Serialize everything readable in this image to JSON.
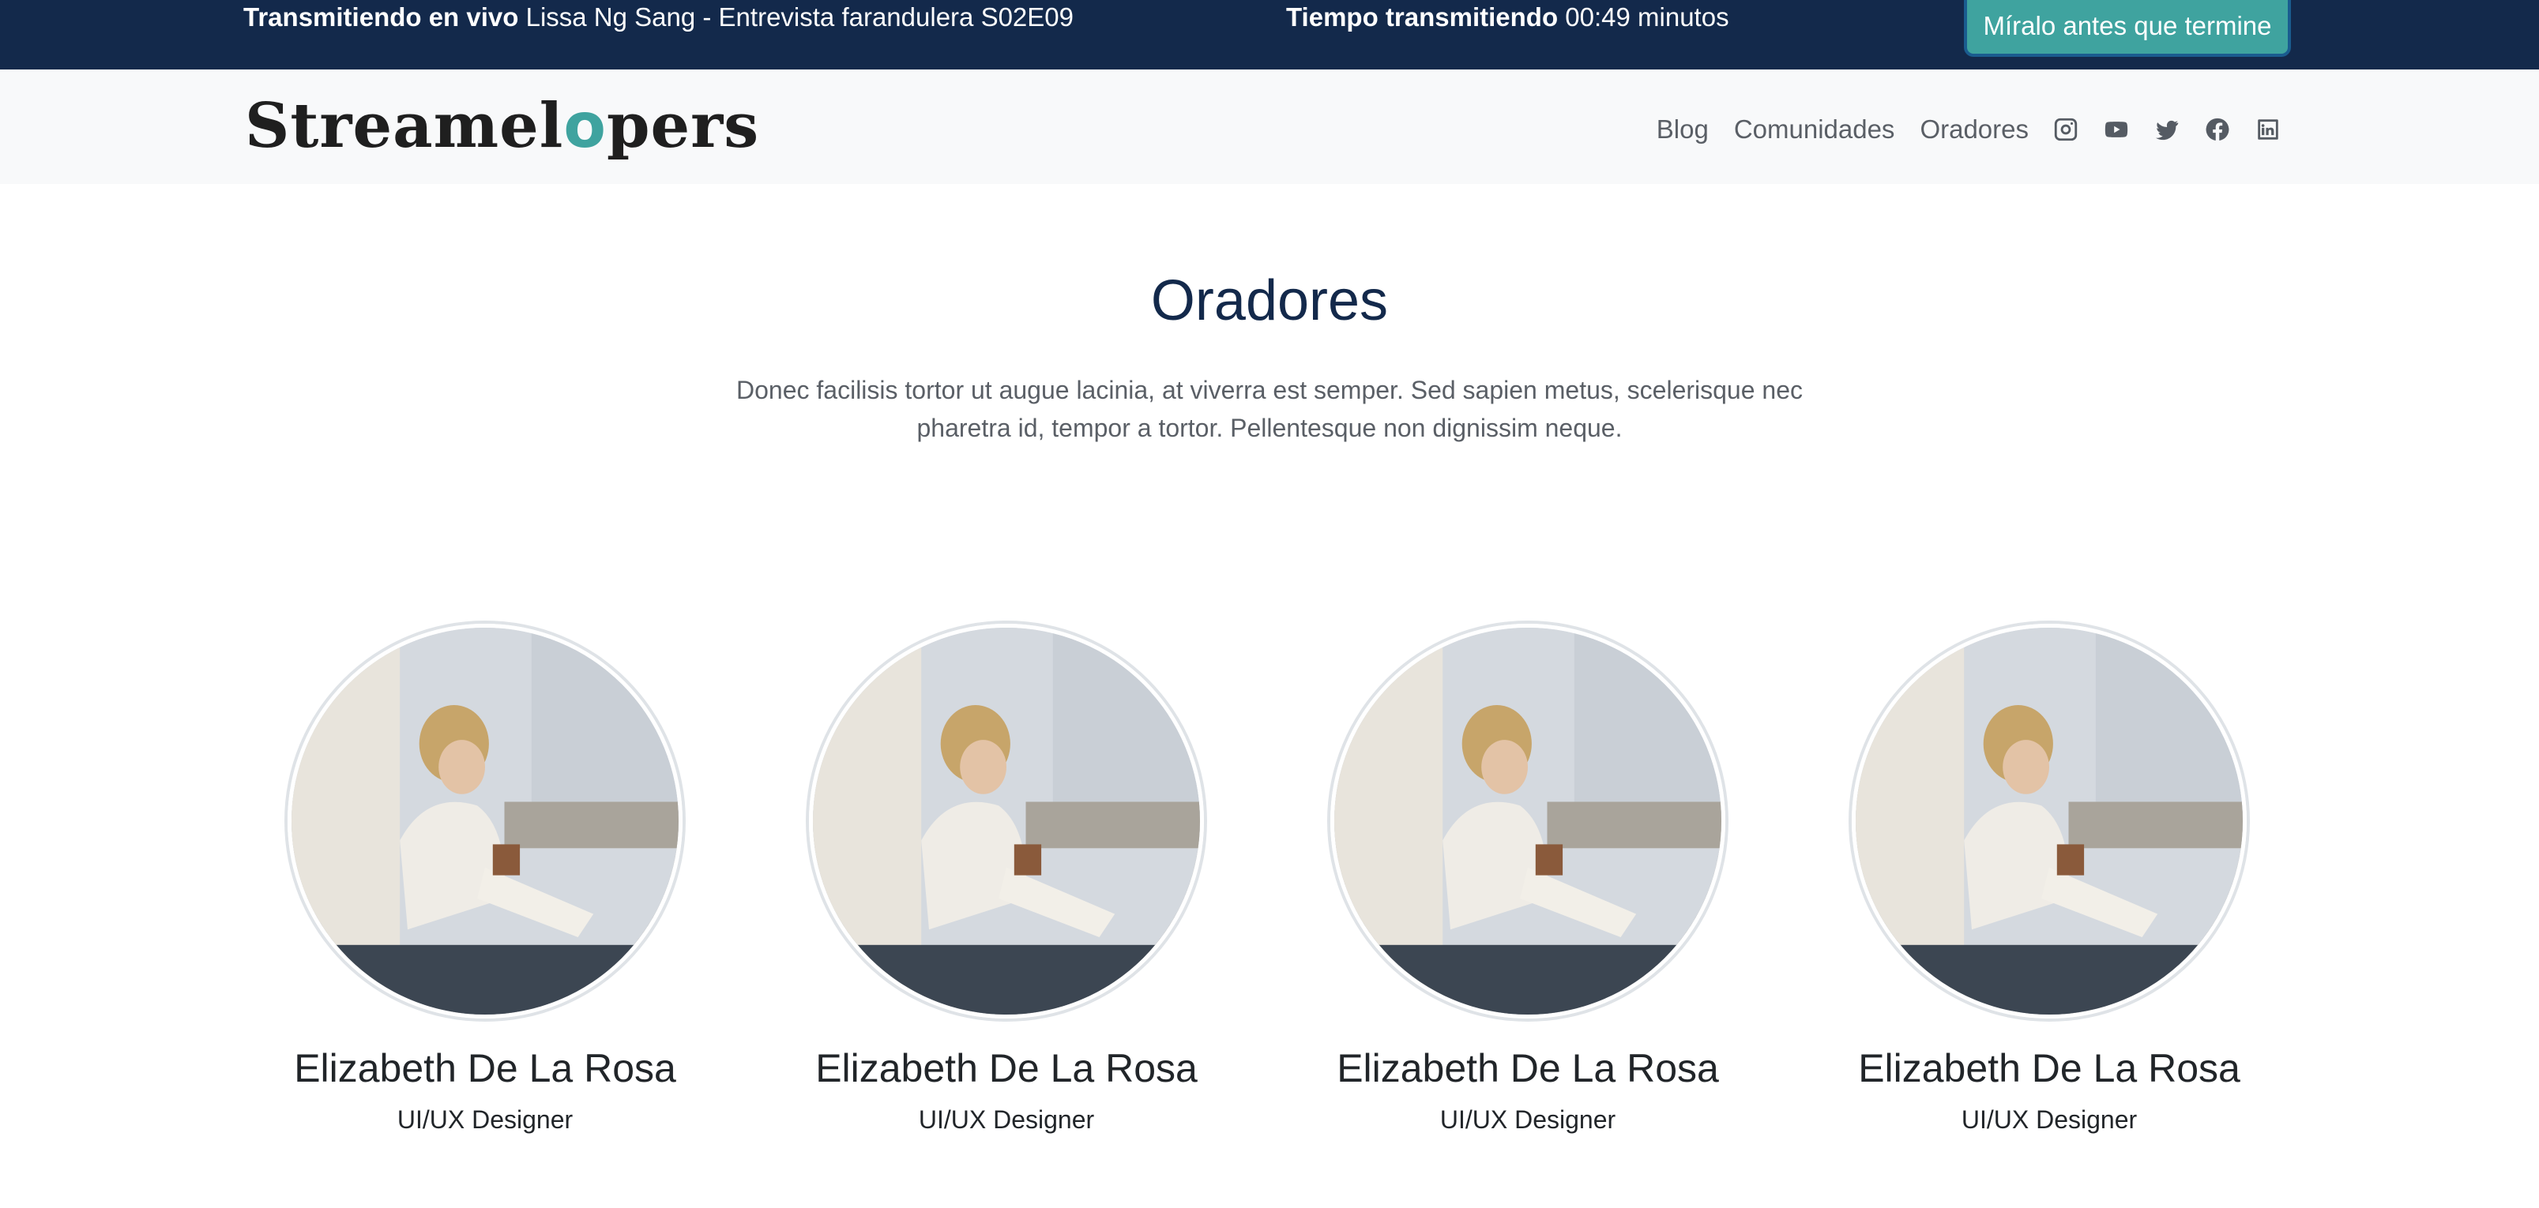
{
  "topbar": {
    "live_label": "Transmitiendo en vivo",
    "live_title": "Lissa Ng Sang - Entrevista farandulera S02E09",
    "time_label": "Tiempo transmitiendo",
    "time_value": "00:49 minutos",
    "cta": "Míralo antes que termine"
  },
  "brand": {
    "logo_left": "Streamel",
    "logo_mid": "o",
    "logo_right": "pers"
  },
  "nav": {
    "links": [
      "Blog",
      "Comunidades",
      "Oradores"
    ],
    "socials": [
      "instagram-icon",
      "youtube-icon",
      "twitter-icon",
      "facebook-icon",
      "linkedin-icon"
    ]
  },
  "hero": {
    "title": "Oradores",
    "description": "Donec facilisis tortor ut augue lacinia, at viverra est semper. Sed sapien metus, scelerisque nec pharetra id, tempor a tortor. Pellentesque non dignissim neque."
  },
  "speakers": [
    {
      "name": "Elizabeth De La Rosa",
      "role": "UI/UX Designer"
    },
    {
      "name": "Elizabeth De La Rosa",
      "role": "UI/UX Designer"
    },
    {
      "name": "Elizabeth De La Rosa",
      "role": "UI/UX Designer"
    },
    {
      "name": "Elizabeth De La Rosa",
      "role": "UI/UX Designer"
    }
  ],
  "colors": {
    "topbar": "#13294b",
    "accent": "#3fa39f",
    "navbar": "#f8f9fa",
    "title": "#13294b"
  }
}
